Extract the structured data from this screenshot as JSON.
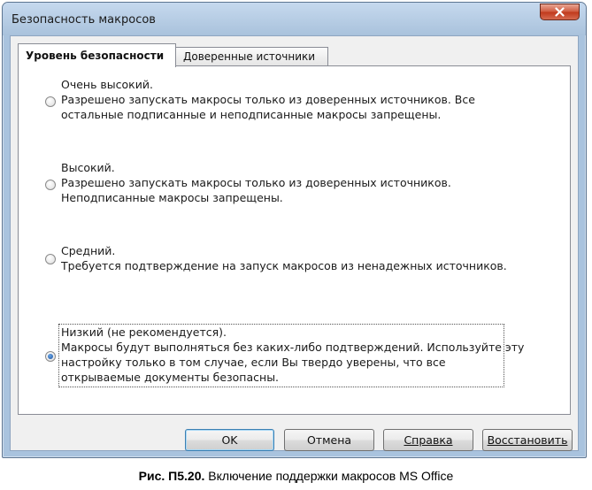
{
  "window": {
    "title": "Безопасность макросов"
  },
  "tabs": [
    {
      "label": "Уровень безопасности",
      "active": true
    },
    {
      "label": "Доверенные источники",
      "active": false
    }
  ],
  "options": [
    {
      "heading": "Очень высокий.",
      "lines": [
        "Разрешено запускать макросы только из доверенных источников. Все",
        "остальные подписанные и неподписанные макросы запрещены."
      ],
      "checked": false
    },
    {
      "heading": "Высокий.",
      "lines": [
        "Разрешено запускать макросы только из доверенных источников.",
        "Неподписанные макросы запрещены."
      ],
      "checked": false
    },
    {
      "heading": "Средний.",
      "lines": [
        "Требуется подтверждение на запуск макросов из ненадежных источников."
      ],
      "checked": false
    },
    {
      "heading": "Низкий (не рекомендуется).",
      "lines": [
        "Макросы будут выполняться без каких-либо подтверждений. Используйте эту",
        "настройку только в том случае, если Вы твердо уверены, что все",
        "открываемые документы безопасны."
      ],
      "checked": true
    }
  ],
  "buttons": {
    "ok": "OK",
    "cancel": "Отмена",
    "help": "Справка",
    "restore": "Восстановить"
  },
  "caption": {
    "label": "Рис. П5.20.",
    "text": " Включение поддержки макросов MS Office"
  },
  "colors": {
    "title_bar": "#b9d1ea",
    "close_button": "#c7462a",
    "radio_selected": "#1a4f9e"
  }
}
